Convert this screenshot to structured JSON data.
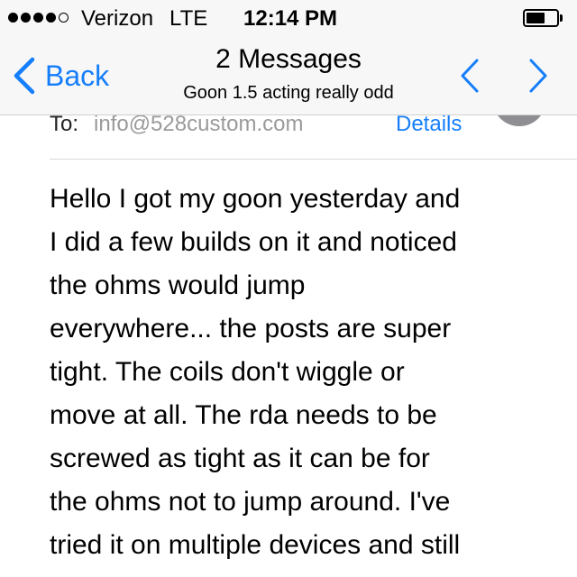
{
  "status_bar": {
    "signal_filled": 4,
    "signal_total": 5,
    "carrier": "Verizon",
    "network": "LTE",
    "time": "12:14 PM",
    "battery_level": 0.62
  },
  "nav": {
    "back_label": "Back",
    "title": "2 Messages",
    "subtitle": "Goon 1.5 acting really odd"
  },
  "header": {
    "to_label": "To:",
    "to_address": "info@528custom.com",
    "details_label": "Details"
  },
  "message": {
    "lines": [
      "Hello I got my goon yesterday and",
      "I did a few builds on it and noticed",
      "the ohms would jump",
      "everywhere... the posts are super",
      "tight. The coils don't wiggle or",
      "move at all. The rda needs to be",
      "screwed as tight as it can be for",
      "the ohms not to jump around. I've",
      "tried it on multiple devices and still"
    ]
  },
  "colors": {
    "ios_blue": "#157efb",
    "bar_background": "#f7f7f7",
    "placeholder_gray": "#9a9a9a",
    "avatar_gray": "#8e8e93"
  }
}
